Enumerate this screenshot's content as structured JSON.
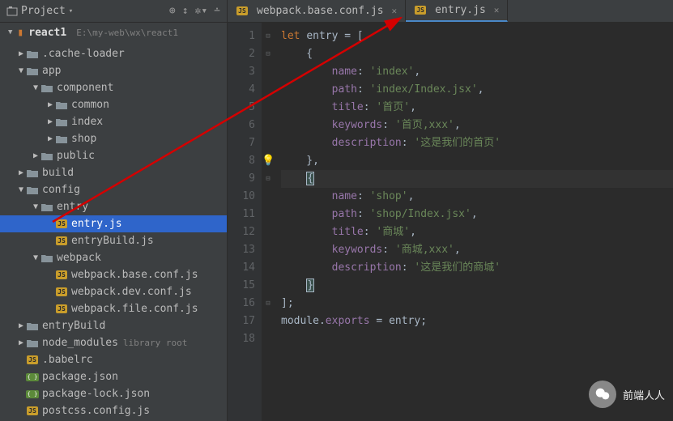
{
  "sidebar": {
    "title": "Project",
    "breadcrumb": {
      "root": "react1",
      "path": "E:\\my-web\\wx\\react1"
    },
    "tree": [
      {
        "depth": 0,
        "label": ".cache-loader",
        "icon": "folder",
        "arrow": "right"
      },
      {
        "depth": 0,
        "label": "app",
        "icon": "folder",
        "arrow": "down"
      },
      {
        "depth": 1,
        "label": "component",
        "icon": "folder",
        "arrow": "down"
      },
      {
        "depth": 2,
        "label": "common",
        "icon": "folder",
        "arrow": "right"
      },
      {
        "depth": 2,
        "label": "index",
        "icon": "folder",
        "arrow": "right"
      },
      {
        "depth": 2,
        "label": "shop",
        "icon": "folder",
        "arrow": "right"
      },
      {
        "depth": 1,
        "label": "public",
        "icon": "folder",
        "arrow": "right"
      },
      {
        "depth": 0,
        "label": "build",
        "icon": "folder",
        "arrow": "right"
      },
      {
        "depth": 0,
        "label": "config",
        "icon": "folder",
        "arrow": "down"
      },
      {
        "depth": 1,
        "label": "entry",
        "icon": "folder",
        "arrow": "down"
      },
      {
        "depth": 2,
        "label": "entry.js",
        "icon": "js",
        "selected": true
      },
      {
        "depth": 2,
        "label": "entryBuild.js",
        "icon": "js"
      },
      {
        "depth": 1,
        "label": "webpack",
        "icon": "folder",
        "arrow": "down"
      },
      {
        "depth": 2,
        "label": "webpack.base.conf.js",
        "icon": "js"
      },
      {
        "depth": 2,
        "label": "webpack.dev.conf.js",
        "icon": "js"
      },
      {
        "depth": 2,
        "label": "webpack.file.conf.js",
        "icon": "js"
      },
      {
        "depth": 0,
        "label": "entryBuild",
        "icon": "folder",
        "arrow": "right"
      },
      {
        "depth": 0,
        "label": "node_modules",
        "icon": "folder",
        "arrow": "right",
        "hint": "library root"
      },
      {
        "depth": 0,
        "label": ".babelrc",
        "icon": "js"
      },
      {
        "depth": 0,
        "label": "package.json",
        "icon": "json"
      },
      {
        "depth": 0,
        "label": "package-lock.json",
        "icon": "json"
      },
      {
        "depth": 0,
        "label": "postcss.config.js",
        "icon": "js"
      }
    ]
  },
  "tabs": [
    {
      "label": "webpack.base.conf.js",
      "icon": "js"
    },
    {
      "label": "entry.js",
      "icon": "js",
      "active": true
    }
  ],
  "code": {
    "lines": [
      "1",
      "2",
      "3",
      "4",
      "5",
      "6",
      "7",
      "8",
      "9",
      "10",
      "11",
      "12",
      "13",
      "14",
      "15",
      "16",
      "17",
      "18"
    ]
  },
  "chart_data": {
    "type": "code",
    "language": "javascript",
    "keyword": "let",
    "varname": "entry",
    "entries": [
      {
        "name": "index",
        "path": "index/Index.jsx",
        "title": "首页",
        "keywords": "首页,xxx",
        "description": "这是我们的首页"
      },
      {
        "name": "shop",
        "path": "shop/Index.jsx",
        "title": "商城",
        "keywords": "商城,xxx",
        "description": "这是我们的商城"
      }
    ],
    "export_line": "module.exports = entry;"
  },
  "watermark": "前端人人"
}
